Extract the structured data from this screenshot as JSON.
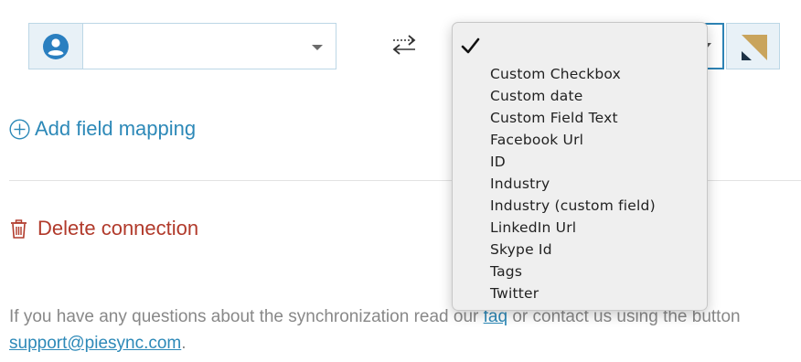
{
  "mapping_row": {
    "left_field_value": "",
    "left_icon": "user-circle-icon",
    "swap_icon": "swap-arrows-icon",
    "right_field_value": "",
    "logo_icon": "app-logo-icon"
  },
  "dropdown": {
    "selected_indicator": "✓",
    "options": [
      "Custom Checkbox",
      "Custom date",
      "Custom Field Text",
      "Facebook Url",
      "ID",
      "Industry",
      "Industry (custom field)",
      "LinkedIn Url",
      "Skype Id",
      "Tags",
      "Twitter"
    ]
  },
  "actions": {
    "add_field_mapping": "Add field mapping",
    "delete_connection": "Delete connection"
  },
  "help": {
    "text_before": "If you have any questions about the synchronization read our ",
    "faq_link": "faq",
    "text_after": " or contact us using the button",
    "email_link": "support@piesync.com",
    "text_end": "."
  },
  "colors": {
    "link_blue": "#2d89b8",
    "delete_red": "#b13a2b",
    "icon_blue": "#2a7fc0",
    "logo_gold": "#c9a45c",
    "logo_navy": "#1d3246"
  }
}
